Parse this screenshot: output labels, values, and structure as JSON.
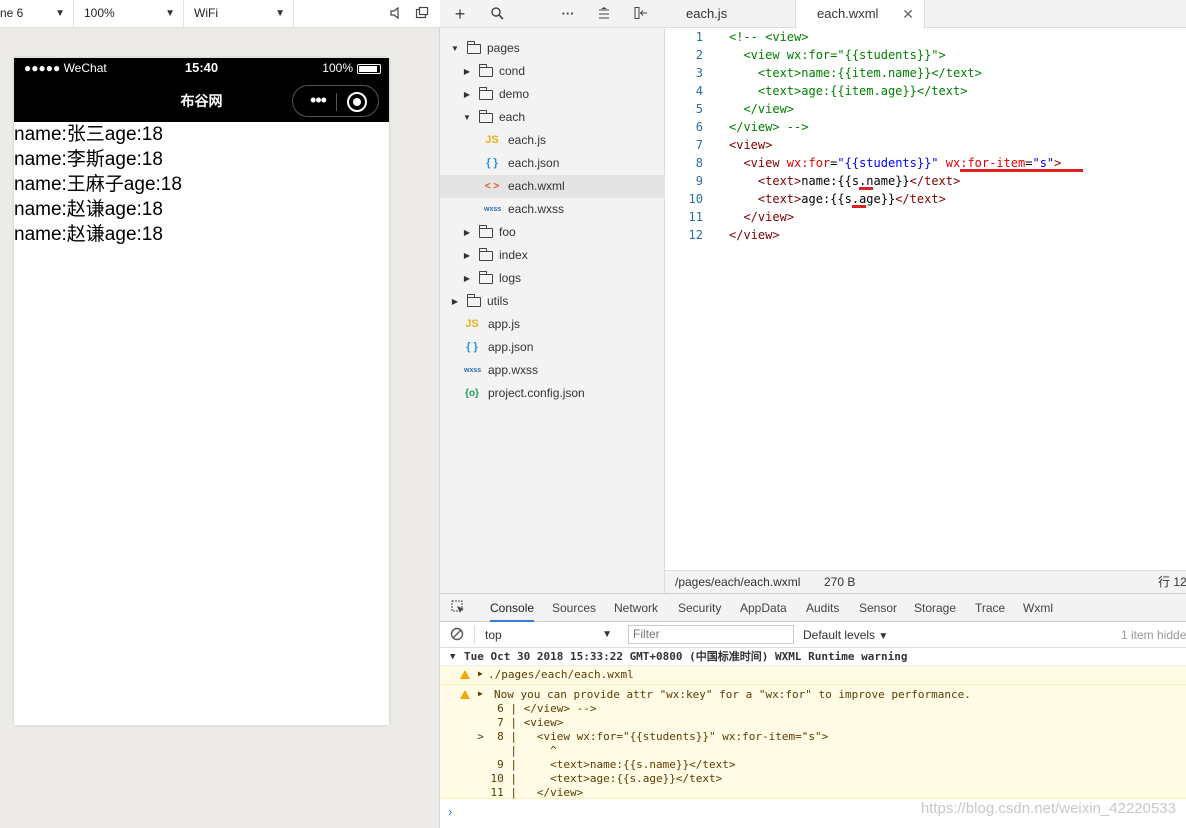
{
  "sim_toolbar": {
    "device": "ne 6",
    "zoom": "100%",
    "network": "WiFi"
  },
  "phone": {
    "carrier": "●●●●● WeChat",
    "time": "15:40",
    "battery": "100%",
    "nav_title": "布谷网",
    "rows": [
      "name:张三age:18",
      "name:李斯age:18",
      "name:王麻子age:18",
      "name:赵谦age:18",
      "name:赵谦age:18"
    ]
  },
  "explorer": {
    "items": [
      {
        "label": "pages",
        "type": "folder",
        "state": "open"
      },
      {
        "label": "cond",
        "type": "folder",
        "state": "closed"
      },
      {
        "label": "demo",
        "type": "folder",
        "state": "closed"
      },
      {
        "label": "each",
        "type": "folder",
        "state": "open"
      },
      {
        "label": "each.js",
        "type": "js",
        "icon": "JS"
      },
      {
        "label": "each.json",
        "type": "json",
        "icon": "{ }"
      },
      {
        "label": "each.wxml",
        "type": "wxml",
        "icon": "< >"
      },
      {
        "label": "each.wxss",
        "type": "wxss",
        "icon": "wxss"
      },
      {
        "label": "foo",
        "type": "folder",
        "state": "closed"
      },
      {
        "label": "index",
        "type": "folder",
        "state": "closed"
      },
      {
        "label": "logs",
        "type": "folder",
        "state": "closed"
      },
      {
        "label": "utils",
        "type": "folder",
        "state": "closed"
      },
      {
        "label": "app.js",
        "type": "js",
        "icon": "JS"
      },
      {
        "label": "app.json",
        "type": "json",
        "icon": "{ }"
      },
      {
        "label": "app.wxss",
        "type": "wxss",
        "icon": "wxss"
      },
      {
        "label": "project.config.json",
        "type": "cfg",
        "icon": "{o}"
      }
    ]
  },
  "editor": {
    "tabs": [
      {
        "label": "each.js"
      },
      {
        "label": "each.wxml"
      }
    ],
    "lines": [
      {
        "n": "1",
        "text": "<!-- <view>"
      },
      {
        "n": "2",
        "text": "  <view wx:for=\"{{students}}\">"
      },
      {
        "n": "3",
        "text": "    <text>name:{{item.name}}</text>"
      },
      {
        "n": "4",
        "text": "    <text>age:{{item.age}}</text>"
      },
      {
        "n": "5",
        "text": "  </view>"
      },
      {
        "n": "6",
        "text": "</view> -->"
      },
      {
        "n": "7",
        "text": "<view>"
      },
      {
        "n": "8",
        "text": "  <view wx:for=\"{{students}}\" wx:for-item=\"s\">"
      },
      {
        "n": "9",
        "text": "    <text>name:{{s.name}}</text>"
      },
      {
        "n": "10",
        "text": "    <text>age:{{s.age}}</text>"
      },
      {
        "n": "11",
        "text": "  </view>"
      },
      {
        "n": "12",
        "text": "</view>"
      }
    ],
    "status": {
      "path": "/pages/each/each.wxml",
      "size": "270 B",
      "position": "行 12"
    }
  },
  "devtools": {
    "tabs": [
      "Console",
      "Sources",
      "Network",
      "Security",
      "AppData",
      "Audits",
      "Sensor",
      "Storage",
      "Trace",
      "Wxml"
    ],
    "context": "top",
    "filter_placeholder": "Filter",
    "levels": "Default levels",
    "hidden_count": "1 item hidde",
    "header": "Tue Oct 30 2018 15:33:22 GMT+0800 (中国标准时间) WXML Runtime warning",
    "warn1": "./pages/each/each.wxml",
    "warn2": "Now you can provide attr \"wx:key\" for a \"wx:for\" to improve performance.",
    "snippet": [
      "     6 | </view> -->",
      "     7 | <view>",
      "  >  8 |   <view wx:for=\"{{students}}\" wx:for-item=\"s\">",
      "       |     ^",
      "     9 |     <text>name:{{s.name}}</text>",
      "    10 |     <text>age:{{s.age}}</text>",
      "    11 |   </view>"
    ],
    "prompt": "›",
    "watermark": "https://blog.csdn.net/weixin_42220533"
  },
  "colors": {
    "accent": "#3a7bd5",
    "warn_bg": "#fffbe5",
    "underline": "#e02020"
  }
}
